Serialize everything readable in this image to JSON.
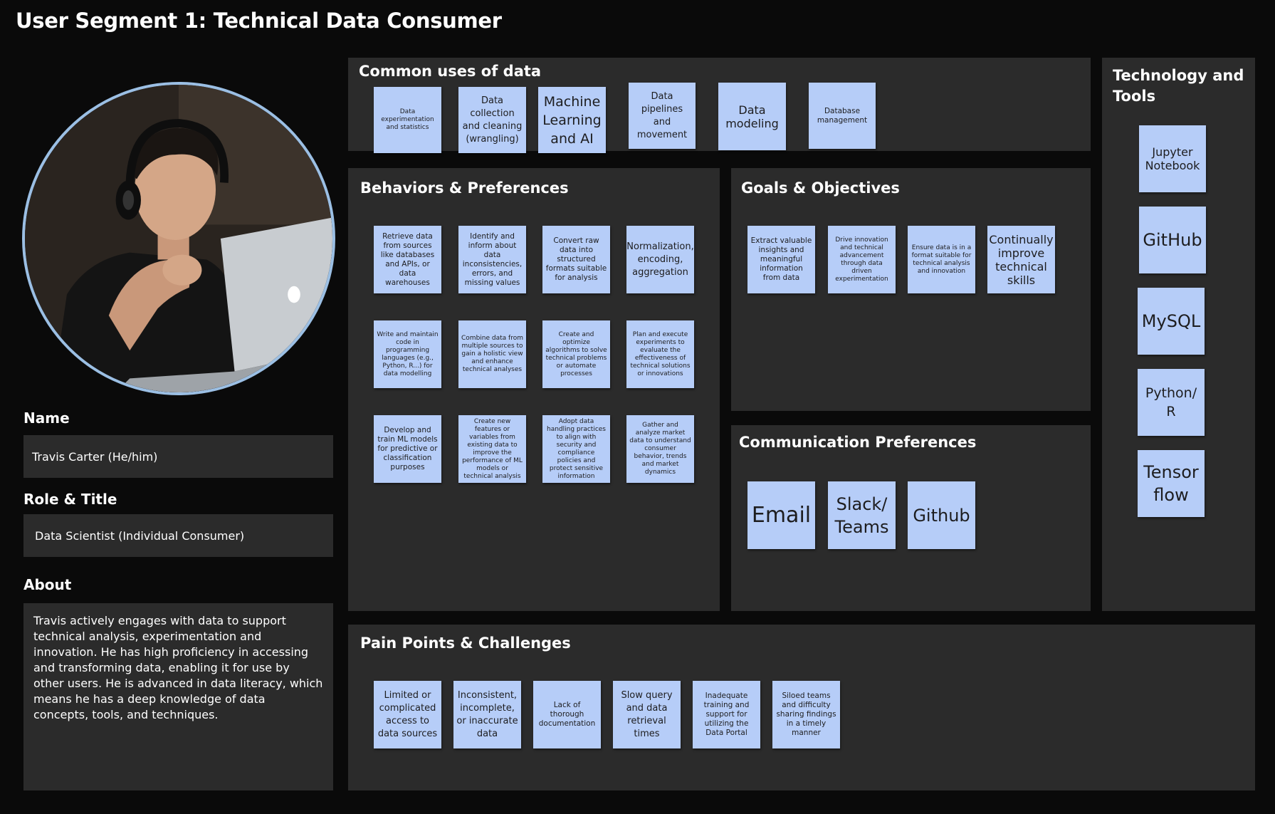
{
  "page": {
    "title": "User Segment 1: Technical Data Consumer"
  },
  "colors": {
    "background": "#0a0a0a",
    "panel": "#2b2b2b",
    "sticky": "#b6cdf8",
    "avatar_border": "#9bbfe4"
  },
  "profile": {
    "name_label": "Name",
    "name_value": "Travis Carter (He/him)",
    "role_label": "Role & Title",
    "role_value": "Data Scientist (Individual Consumer)",
    "about_label": "About",
    "about_value": "Travis actively engages with data to support technical analysis, experimentation and innovation. He has high proficiency in accessing and transforming data, enabling it for use by other users. He is advanced in data literacy, which means he has a deep knowledge of data concepts, tools, and techniques."
  },
  "common_uses": {
    "title": "Common uses of data",
    "notes": [
      "Data experimentation and statistics",
      "Data collection and cleaning (wrangling)",
      "Machine Learning and AI",
      "Data pipelines and movement",
      "Data modeling",
      "Database management"
    ]
  },
  "behaviors": {
    "title": "Behaviors & Preferences",
    "notes": [
      "Retrieve data from sources like databases and APIs, or data warehouses",
      "Identify and inform about data inconsistencies, errors, and missing values",
      "Convert raw data into structured formats suitable for analysis",
      "Normalization, encoding, aggregation",
      "Write and maintain code in programming languages (e.g., Python, R...) for data modelling",
      "Combine data from multiple sources to gain a holistic view and enhance technical analyses",
      "Create and optimize algorithms to solve technical problems or automate processes",
      "Plan and execute experiments to evaluate the effectiveness of technical solutions or innovations",
      "Develop and train ML models for predictive or classification purposes",
      "Create new features or variables from existing data to improve the performance of ML models or technical analysis",
      "Adopt data handling practices to align with security and compliance policies and protect sensitive information",
      "Gather and analyze market data to understand consumer behavior, trends and market dynamics"
    ]
  },
  "goals": {
    "title": "Goals & Objectives",
    "notes": [
      "Extract valuable insights and meaningful information from data",
      "Drive innovation and technical advancement through data driven experimentation",
      "Ensure data is in a format suitable for technical analysis and innovation",
      "Continually improve technical skills"
    ]
  },
  "communication": {
    "title": "Communication Preferences",
    "notes": [
      "Email",
      "Slack/ Teams",
      "Github"
    ]
  },
  "technology": {
    "title": "Technology and Tools",
    "notes": [
      "Jupyter Notebook",
      "GitHub",
      "MySQL",
      "Python/ R",
      "Tensor flow"
    ]
  },
  "pain_points": {
    "title": "Pain Points & Challenges",
    "notes": [
      "Limited or complicated access to data sources",
      "Inconsistent, incomplete, or inaccurate data",
      "Lack of thorough documentation",
      "Slow query and data retrieval times",
      "Inadequate training and support for utilizing the Data Portal",
      "Siloed teams and difficulty sharing findings in a timely manner"
    ]
  }
}
